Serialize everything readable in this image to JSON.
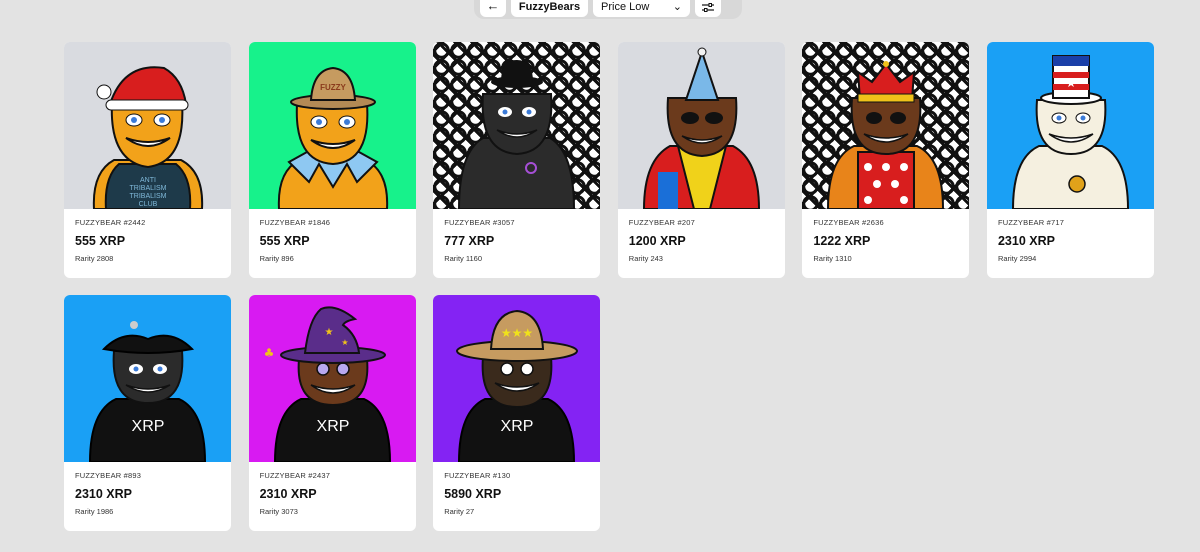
{
  "toolbar": {
    "back_icon": "arrow-left-icon",
    "collection_label": "FuzzyBears",
    "sort_value": "Price Low",
    "filter_icon": "sliders-icon"
  },
  "cards": [
    {
      "name": "FUZZYBEAR #2442",
      "price": "555 XRP",
      "rarity": "Rarity 2808"
    },
    {
      "name": "FUZZYBEAR #1846",
      "price": "555 XRP",
      "rarity": "Rarity 896"
    },
    {
      "name": "FUZZYBEAR #3057",
      "price": "777 XRP",
      "rarity": "Rarity 1160"
    },
    {
      "name": "FUZZYBEAR #207",
      "price": "1200 XRP",
      "rarity": "Rarity 243"
    },
    {
      "name": "FUZZYBEAR #2636",
      "price": "1222 XRP",
      "rarity": "Rarity 1310"
    },
    {
      "name": "FUZZYBEAR #717",
      "price": "2310 XRP",
      "rarity": "Rarity 2994"
    },
    {
      "name": "FUZZYBEAR #893",
      "price": "2310 XRP",
      "rarity": "Rarity 1986"
    },
    {
      "name": "FUZZYBEAR #2437",
      "price": "2310 XRP",
      "rarity": "Rarity 3073"
    },
    {
      "name": "FUZZYBEAR #130",
      "price": "5890 XRP",
      "rarity": "Rarity 27"
    }
  ],
  "shirt_texts": {
    "card0": "ANTI TRIBALISM TRIBALISM CLUB",
    "card1_hat": "FUZZY",
    "xrp": "XRP"
  },
  "colors": {
    "page_bg": "#e3e3e3",
    "bg_grey": "#d9dbe0",
    "bg_green": "#17f28b",
    "bg_blue": "#1aa0f5",
    "bg_magenta": "#d81af2",
    "bg_purple": "#8423f3"
  }
}
